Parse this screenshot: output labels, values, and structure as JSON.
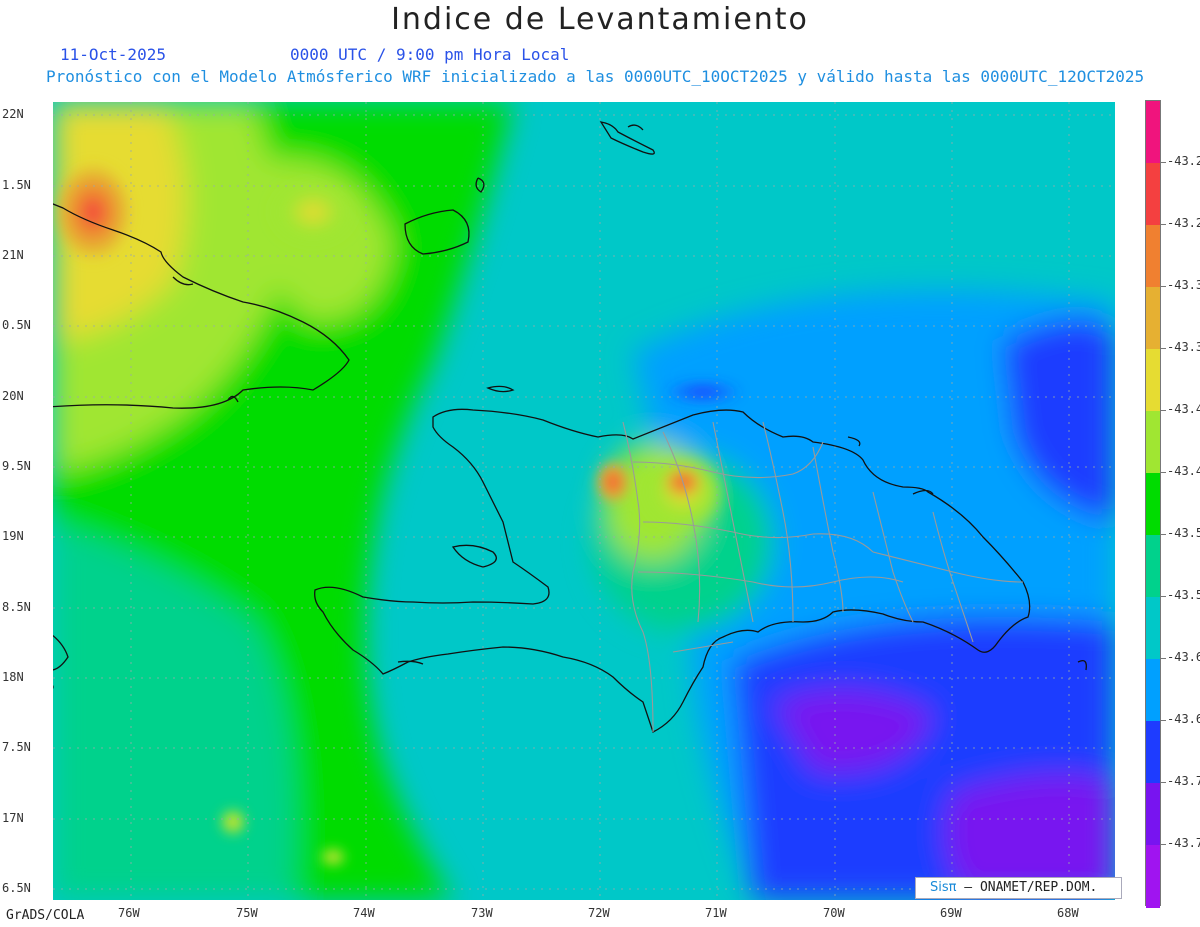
{
  "title": "Indice de Levantamiento",
  "date": "11-Oct-2025",
  "time": "0000 UTC / 9:00 pm Hora Local",
  "forecast_info": "Pronóstico con el Modelo Atmósferico WRF inicializado a las 0000UTC_10OCT2025 y válido hasta las  0000UTC_12OCT2025",
  "footer": "GrADS/COLA",
  "credit": {
    "logo": "Sisπ",
    "text": "– ONAMET/REP.DOM."
  },
  "lat_labels": [
    "22N",
    "1.5N",
    "21N",
    "0.5N",
    "20N",
    "9.5N",
    "19N",
    "8.5N",
    "18N",
    "7.5N",
    "17N",
    "6.5N"
  ],
  "lon_labels": [
    "76W",
    "75W",
    "74W",
    "73W",
    "72W",
    "71W",
    "70W",
    "69W",
    "68W"
  ],
  "colorbar": {
    "colors": [
      "#f0147d",
      "#f44040",
      "#f08030",
      "#e6b032",
      "#e6dc32",
      "#a0e632",
      "#00dc00",
      "#00d28c",
      "#00c8c8",
      "#00a0ff",
      "#1e3cff",
      "#7814f0",
      "#a014f0"
    ],
    "labels": [
      "-43.2",
      "-43.2",
      "-43.3",
      "-43.3",
      "-43.4",
      "-43.4",
      "-43.5",
      "-43.5",
      "-43.6",
      "-43.6",
      "-43.7",
      "-43.7"
    ]
  }
}
